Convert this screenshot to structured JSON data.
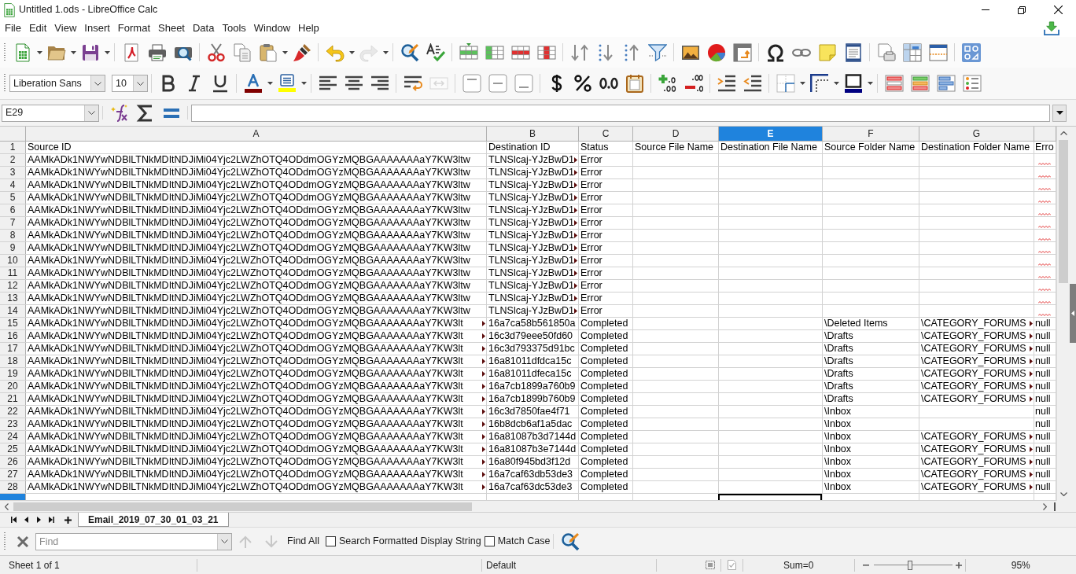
{
  "window": {
    "title": "Untitled 1.ods - LibreOffice Calc"
  },
  "menu": [
    "File",
    "Edit",
    "View",
    "Insert",
    "Format",
    "Sheet",
    "Data",
    "Tools",
    "Window",
    "Help"
  ],
  "standard_toolbar": {
    "undo": {
      "disabled": false
    },
    "redo": {
      "disabled": true
    }
  },
  "formatting_toolbar": {
    "font_name": "Liberation Sans",
    "font_size": "10",
    "merge_cells": {
      "disabled": true
    }
  },
  "formula_bar": {
    "name_box": "E29"
  },
  "sheet": {
    "columns": [
      {
        "letter": "A",
        "selected": false
      },
      {
        "letter": "B",
        "selected": false
      },
      {
        "letter": "C",
        "selected": false
      },
      {
        "letter": "D",
        "selected": false
      },
      {
        "letter": "E",
        "selected": true
      },
      {
        "letter": "F",
        "selected": false
      },
      {
        "letter": "G",
        "selected": false
      },
      {
        "selected": false
      }
    ],
    "rows": [
      {
        "number": "1",
        "selected": false,
        "cells": [
          {
            "text": "Source ID"
          },
          {
            "text": "Destination ID"
          },
          {
            "text": "Status"
          },
          {
            "text": "Source File Name"
          },
          {
            "text": "Destination File Name"
          },
          {
            "text": "Source Folder Name"
          },
          {
            "text": "Destination Folder Name"
          },
          {
            "text": "Erro"
          }
        ]
      },
      {
        "number": "2",
        "selected": false,
        "cells": [
          {
            "text": "AAMkADk1NWYwNDBlLTNkMDItNDJiMi04Yjc2LWZhOTQ4ODdmOGYzMQBGAAAAAAAaY7KW3ltw"
          },
          {
            "text": "TLNSlcaj-YJzBwD1",
            "clipped": true
          },
          {
            "text": "Error"
          },
          {},
          {},
          {},
          {},
          {
            "spell_error": true
          }
        ]
      },
      {
        "number": "3",
        "selected": false,
        "cells": [
          {
            "text": "AAMkADk1NWYwNDBlLTNkMDItNDJiMi04Yjc2LWZhOTQ4ODdmOGYzMQBGAAAAAAAaY7KW3ltw"
          },
          {
            "text": "TLNSlcaj-YJzBwD1",
            "clipped": true
          },
          {
            "text": "Error"
          },
          {},
          {},
          {},
          {},
          {
            "spell_error": true
          }
        ]
      },
      {
        "number": "4",
        "selected": false,
        "cells": [
          {
            "text": "AAMkADk1NWYwNDBlLTNkMDItNDJiMi04Yjc2LWZhOTQ4ODdmOGYzMQBGAAAAAAAaY7KW3ltw"
          },
          {
            "text": "TLNSlcaj-YJzBwD1",
            "clipped": true
          },
          {
            "text": "Error"
          },
          {},
          {},
          {},
          {},
          {
            "spell_error": true
          }
        ]
      },
      {
        "number": "5",
        "selected": false,
        "cells": [
          {
            "text": "AAMkADk1NWYwNDBlLTNkMDItNDJiMi04Yjc2LWZhOTQ4ODdmOGYzMQBGAAAAAAAaY7KW3ltw"
          },
          {
            "text": "TLNSlcaj-YJzBwD1",
            "clipped": true
          },
          {
            "text": "Error"
          },
          {},
          {},
          {},
          {},
          {
            "spell_error": true
          }
        ]
      },
      {
        "number": "6",
        "selected": false,
        "cells": [
          {
            "text": "AAMkADk1NWYwNDBlLTNkMDItNDJiMi04Yjc2LWZhOTQ4ODdmOGYzMQBGAAAAAAAaY7KW3ltw"
          },
          {
            "text": "TLNSlcaj-YJzBwD1",
            "clipped": true
          },
          {
            "text": "Error"
          },
          {},
          {},
          {},
          {},
          {
            "spell_error": true
          }
        ]
      },
      {
        "number": "7",
        "selected": false,
        "cells": [
          {
            "text": "AAMkADk1NWYwNDBlLTNkMDItNDJiMi04Yjc2LWZhOTQ4ODdmOGYzMQBGAAAAAAAaY7KW3ltw"
          },
          {
            "text": "TLNSlcaj-YJzBwD1",
            "clipped": true
          },
          {
            "text": "Error"
          },
          {},
          {},
          {},
          {},
          {
            "spell_error": true
          }
        ]
      },
      {
        "number": "8",
        "selected": false,
        "cells": [
          {
            "text": "AAMkADk1NWYwNDBlLTNkMDItNDJiMi04Yjc2LWZhOTQ4ODdmOGYzMQBGAAAAAAAaY7KW3ltw"
          },
          {
            "text": "TLNSlcaj-YJzBwD1",
            "clipped": true
          },
          {
            "text": "Error"
          },
          {},
          {},
          {},
          {},
          {
            "spell_error": true
          }
        ]
      },
      {
        "number": "9",
        "selected": false,
        "cells": [
          {
            "text": "AAMkADk1NWYwNDBlLTNkMDItNDJiMi04Yjc2LWZhOTQ4ODdmOGYzMQBGAAAAAAAaY7KW3ltw"
          },
          {
            "text": "TLNSlcaj-YJzBwD1",
            "clipped": true
          },
          {
            "text": "Error"
          },
          {},
          {},
          {},
          {},
          {
            "spell_error": true
          }
        ]
      },
      {
        "number": "10",
        "selected": false,
        "cells": [
          {
            "text": "AAMkADk1NWYwNDBlLTNkMDItNDJiMi04Yjc2LWZhOTQ4ODdmOGYzMQBGAAAAAAAaY7KW3ltw"
          },
          {
            "text": "TLNSlcaj-YJzBwD1",
            "clipped": true
          },
          {
            "text": "Error"
          },
          {},
          {},
          {},
          {},
          {
            "spell_error": true
          }
        ]
      },
      {
        "number": "11",
        "selected": false,
        "cells": [
          {
            "text": "AAMkADk1NWYwNDBlLTNkMDItNDJiMi04Yjc2LWZhOTQ4ODdmOGYzMQBGAAAAAAAaY7KW3ltw"
          },
          {
            "text": "TLNSlcaj-YJzBwD1",
            "clipped": true
          },
          {
            "text": "Error"
          },
          {},
          {},
          {},
          {},
          {
            "spell_error": true
          }
        ]
      },
      {
        "number": "12",
        "selected": false,
        "cells": [
          {
            "text": "AAMkADk1NWYwNDBlLTNkMDItNDJiMi04Yjc2LWZhOTQ4ODdmOGYzMQBGAAAAAAAaY7KW3ltw"
          },
          {
            "text": "TLNSlcaj-YJzBwD1",
            "clipped": true
          },
          {
            "text": "Error"
          },
          {},
          {},
          {},
          {},
          {
            "spell_error": true
          }
        ]
      },
      {
        "number": "13",
        "selected": false,
        "cells": [
          {
            "text": "AAMkADk1NWYwNDBlLTNkMDItNDJiMi04Yjc2LWZhOTQ4ODdmOGYzMQBGAAAAAAAaY7KW3ltw"
          },
          {
            "text": "TLNSlcaj-YJzBwD1",
            "clipped": true
          },
          {
            "text": "Error"
          },
          {},
          {},
          {},
          {},
          {
            "spell_error": true
          }
        ]
      },
      {
        "number": "14",
        "selected": false,
        "cells": [
          {
            "text": "AAMkADk1NWYwNDBlLTNkMDItNDJiMi04Yjc2LWZhOTQ4ODdmOGYzMQBGAAAAAAAaY7KW3ltw"
          },
          {
            "text": "TLNSlcaj-YJzBwD1",
            "clipped": true
          },
          {
            "text": "Error"
          },
          {},
          {},
          {},
          {},
          {
            "spell_error": true
          }
        ]
      },
      {
        "number": "15",
        "selected": false,
        "cells": [
          {
            "text": "AAMkADk1NWYwNDBlLTNkMDItNDJiMi04Yjc2LWZhOTQ4ODdmOGYzMQBGAAAAAAAaY7KW3lt",
            "clipped": true
          },
          {
            "text": "16a7ca58b561850a"
          },
          {
            "text": "Completed"
          },
          {},
          {},
          {
            "text": "\\Deleted Items"
          },
          {
            "text": "\\CATEGORY_FORUMS",
            "clipped": true
          },
          {
            "text": "null"
          }
        ]
      },
      {
        "number": "16",
        "selected": false,
        "cells": [
          {
            "text": "AAMkADk1NWYwNDBlLTNkMDItNDJiMi04Yjc2LWZhOTQ4ODdmOGYzMQBGAAAAAAAaY7KW3lt",
            "clipped": true
          },
          {
            "text": "16c3d79eee50fd60"
          },
          {
            "text": "Completed"
          },
          {},
          {},
          {
            "text": "\\Drafts"
          },
          {
            "text": "\\CATEGORY_FORUMS",
            "clipped": true
          },
          {
            "text": "null"
          }
        ]
      },
      {
        "number": "17",
        "selected": false,
        "cells": [
          {
            "text": "AAMkADk1NWYwNDBlLTNkMDItNDJiMi04Yjc2LWZhOTQ4ODdmOGYzMQBGAAAAAAAaY7KW3lt",
            "clipped": true
          },
          {
            "text": "16c3d793375d91bc"
          },
          {
            "text": "Completed"
          },
          {},
          {},
          {
            "text": "\\Drafts"
          },
          {
            "text": "\\CATEGORY_FORUMS",
            "clipped": true
          },
          {
            "text": "null"
          }
        ]
      },
      {
        "number": "18",
        "selected": false,
        "cells": [
          {
            "text": "AAMkADk1NWYwNDBlLTNkMDItNDJiMi04Yjc2LWZhOTQ4ODdmOGYzMQBGAAAAAAAaY7KW3lt",
            "clipped": true
          },
          {
            "text": "16a81011dfdca15c"
          },
          {
            "text": "Completed"
          },
          {},
          {},
          {
            "text": "\\Drafts"
          },
          {
            "text": "\\CATEGORY_FORUMS",
            "clipped": true
          },
          {
            "text": "null"
          }
        ]
      },
      {
        "number": "19",
        "selected": false,
        "cells": [
          {
            "text": "AAMkADk1NWYwNDBlLTNkMDItNDJiMi04Yjc2LWZhOTQ4ODdmOGYzMQBGAAAAAAAaY7KW3lt",
            "clipped": true
          },
          {
            "text": "16a81011dfeca15c"
          },
          {
            "text": "Completed"
          },
          {},
          {},
          {
            "text": "\\Drafts"
          },
          {
            "text": "\\CATEGORY_FORUMS",
            "clipped": true
          },
          {
            "text": "null"
          }
        ]
      },
      {
        "number": "20",
        "selected": false,
        "cells": [
          {
            "text": "AAMkADk1NWYwNDBlLTNkMDItNDJiMi04Yjc2LWZhOTQ4ODdmOGYzMQBGAAAAAAAaY7KW3lt",
            "clipped": true
          },
          {
            "text": "16a7cb1899a760b9"
          },
          {
            "text": "Completed"
          },
          {},
          {},
          {
            "text": "\\Drafts"
          },
          {
            "text": "\\CATEGORY_FORUMS",
            "clipped": true
          },
          {
            "text": "null"
          }
        ]
      },
      {
        "number": "21",
        "selected": false,
        "cells": [
          {
            "text": "AAMkADk1NWYwNDBlLTNkMDItNDJiMi04Yjc2LWZhOTQ4ODdmOGYzMQBGAAAAAAAaY7KW3lt",
            "clipped": true
          },
          {
            "text": "16a7cb1899b760b9"
          },
          {
            "text": "Completed"
          },
          {},
          {},
          {
            "text": "\\Drafts"
          },
          {
            "text": "\\CATEGORY_FORUMS",
            "clipped": true
          },
          {
            "text": "null"
          }
        ]
      },
      {
        "number": "22",
        "selected": false,
        "cells": [
          {
            "text": "AAMkADk1NWYwNDBlLTNkMDItNDJiMi04Yjc2LWZhOTQ4ODdmOGYzMQBGAAAAAAAaY7KW3lt",
            "clipped": true
          },
          {
            "text": "16c3d7850fae4f71"
          },
          {
            "text": "Completed"
          },
          {},
          {},
          {
            "text": "\\Inbox"
          },
          {},
          {
            "text": "null"
          }
        ]
      },
      {
        "number": "23",
        "selected": false,
        "cells": [
          {
            "text": "AAMkADk1NWYwNDBlLTNkMDItNDJiMi04Yjc2LWZhOTQ4ODdmOGYzMQBGAAAAAAAaY7KW3lt",
            "clipped": true
          },
          {
            "text": "16b8dcb6af1a5dac"
          },
          {
            "text": "Completed"
          },
          {},
          {},
          {
            "text": "\\Inbox"
          },
          {},
          {
            "text": "null"
          }
        ]
      },
      {
        "number": "24",
        "selected": false,
        "cells": [
          {
            "text": "AAMkADk1NWYwNDBlLTNkMDItNDJiMi04Yjc2LWZhOTQ4ODdmOGYzMQBGAAAAAAAaY7KW3lt",
            "clipped": true
          },
          {
            "text": "16a81087b3d7144d"
          },
          {
            "text": "Completed"
          },
          {},
          {},
          {
            "text": "\\Inbox"
          },
          {
            "text": "\\CATEGORY_FORUMS",
            "clipped": true
          },
          {
            "text": "null"
          }
        ]
      },
      {
        "number": "25",
        "selected": false,
        "cells": [
          {
            "text": "AAMkADk1NWYwNDBlLTNkMDItNDJiMi04Yjc2LWZhOTQ4ODdmOGYzMQBGAAAAAAAaY7KW3lt",
            "clipped": true
          },
          {
            "text": "16a81087b3e7144d"
          },
          {
            "text": "Completed"
          },
          {},
          {},
          {
            "text": "\\Inbox"
          },
          {
            "text": "\\CATEGORY_FORUMS",
            "clipped": true
          },
          {
            "text": "null"
          }
        ]
      },
      {
        "number": "26",
        "selected": false,
        "cells": [
          {
            "text": "AAMkADk1NWYwNDBlLTNkMDItNDJiMi04Yjc2LWZhOTQ4ODdmOGYzMQBGAAAAAAAaY7KW3lt",
            "clipped": true
          },
          {
            "text": "16a80f945bd3f12d"
          },
          {
            "text": "Completed"
          },
          {},
          {},
          {
            "text": "\\Inbox"
          },
          {
            "text": "\\CATEGORY_FORUMS",
            "clipped": true
          },
          {
            "text": "null"
          }
        ]
      },
      {
        "number": "27",
        "selected": false,
        "cells": [
          {
            "text": "AAMkADk1NWYwNDBlLTNkMDItNDJiMi04Yjc2LWZhOTQ4ODdmOGYzMQBGAAAAAAAaY7KW3lt",
            "clipped": true
          },
          {
            "text": "16a7caf63db53de3"
          },
          {
            "text": "Completed"
          },
          {},
          {},
          {
            "text": "\\Inbox"
          },
          {
            "text": "\\CATEGORY_FORUMS",
            "clipped": true
          },
          {
            "text": "null"
          }
        ]
      },
      {
        "number": "28",
        "selected": false,
        "cells": [
          {
            "text": "AAMkADk1NWYwNDBlLTNkMDItNDJiMi04Yjc2LWZhOTQ4ODdmOGYzMQBGAAAAAAAaY7KW3lt",
            "clipped": true
          },
          {
            "text": "16a7caf63dc53de3"
          },
          {
            "text": "Completed"
          },
          {},
          {},
          {
            "text": "\\Inbox"
          },
          {
            "text": "\\CATEGORY_FORUMS",
            "clipped": true
          },
          {
            "text": "null"
          }
        ]
      },
      {
        "selected": true,
        "cells": [
          {},
          {},
          {},
          {},
          {
            "active": true
          },
          {},
          {},
          {}
        ]
      }
    ]
  },
  "sheet_tabs": [
    {
      "label": "Email_2019_07_30_01_03_21",
      "selected": true
    }
  ],
  "find_toolbar": {
    "placeholder": "Find",
    "find_previous": {
      "disabled": true
    },
    "find_next": {
      "disabled": true
    },
    "find_all": "Find All",
    "options": [
      {
        "label": "Search Formatted Display String",
        "checked": false
      },
      {
        "label": "Match Case",
        "checked": false
      }
    ]
  },
  "status_bar": {
    "sheet": "Sheet 1 of 1",
    "page_style": "Default",
    "sum": "Sum=0",
    "zoom": {
      "level": 0.46,
      "reading": "95%"
    }
  }
}
